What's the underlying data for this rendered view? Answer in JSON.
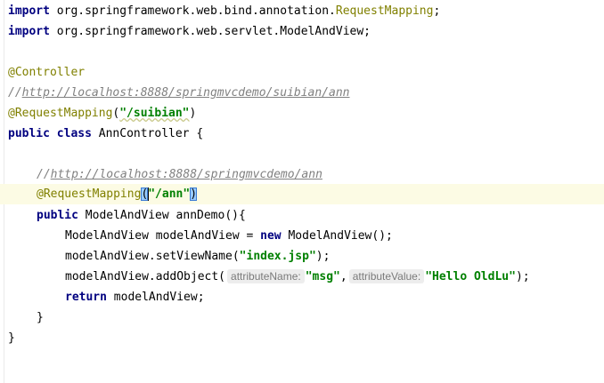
{
  "code": {
    "import1": {
      "keyword": "import",
      "path": "org.springframework.web.bind.annotation.",
      "cls": "RequestMapping",
      "end": ";"
    },
    "import2": {
      "keyword": "import",
      "path": "org.springframework.web.servlet.ModelAndView;"
    },
    "controller_annotation": "@Controller",
    "comment1_prefix": "//",
    "comment1_url": "http://localhost:8888/springmvcdemo/suibian/ann",
    "class_mapping": {
      "annotation": "@RequestMapping",
      "open": "(",
      "value": "\"/suibian\"",
      "close": ")"
    },
    "class_decl": {
      "kw1": "public",
      "kw2": "class",
      "rest": " AnnController {"
    },
    "comment2_prefix": "//",
    "comment2_url": "http://localhost:8888/springmvcdemo/ann",
    "method_mapping": {
      "annotation": "@RequestMapping",
      "open": "(",
      "value": "\"/ann\"",
      "close": ")"
    },
    "method_decl": {
      "kw": "public",
      "rest": " ModelAndView annDemo(){"
    },
    "line_new": {
      "before": "ModelAndView modelAndView = ",
      "kw": "new",
      "after": " ModelAndView();"
    },
    "line_setview": {
      "before": "modelAndView.setViewName(",
      "value": "\"index.jsp\"",
      "after": ");"
    },
    "line_addobject": {
      "before": "modelAndView.addObject(",
      "hint1": "attributeName:",
      "value1": "\"msg\"",
      "comma": ",",
      "hint2": "attributeValue:",
      "value2": "\"Hello OldLu\"",
      "after": ");"
    },
    "line_return": {
      "kw": "return",
      "rest": " modelAndView;"
    },
    "method_close": "}",
    "class_close": "}"
  }
}
